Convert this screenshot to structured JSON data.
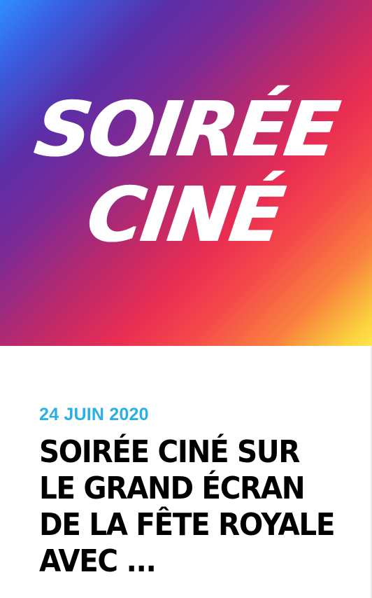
{
  "hero": {
    "title_line_1": "SOIRÉE",
    "title_line_2": "CINÉ",
    "gradient_colors": [
      "#2f8fff",
      "#5a2ea8",
      "#b8296d",
      "#ea2d52",
      "#f9813f",
      "#fde64a"
    ]
  },
  "article": {
    "date": "24 JUIN 2020",
    "headline": "SOIRÉE CINÉ SUR LE GRAND ÉCRAN DE LA FÊTE ROYALE AVEC ...",
    "date_color": "#29b0e6"
  }
}
